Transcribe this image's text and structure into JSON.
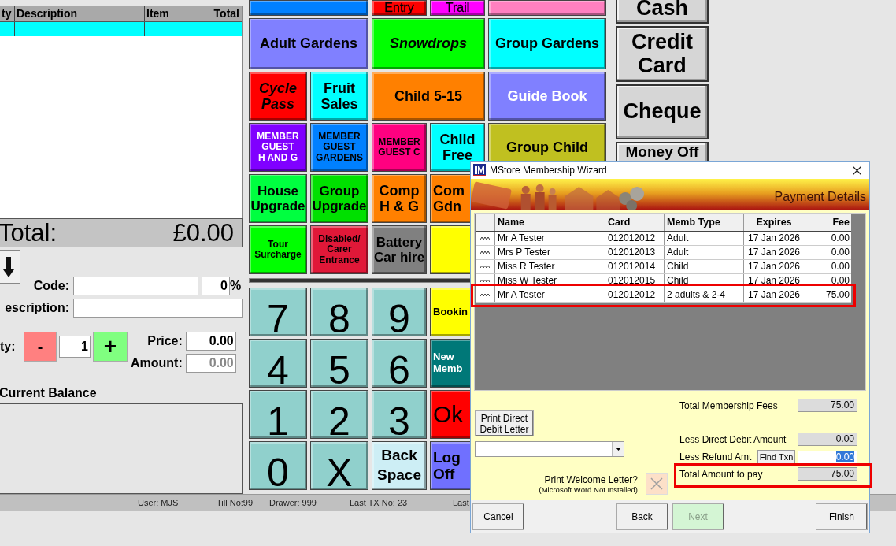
{
  "order_table": {
    "columns": [
      "ty",
      "Description",
      "Item",
      "Total"
    ]
  },
  "total": {
    "label": "Total:",
    "value": "£0.00"
  },
  "entry": {
    "code_label": "Code:",
    "discount": "0",
    "percent": "%",
    "description_label": "escription:",
    "qty_label": "ty:",
    "minus": "-",
    "qty": "1",
    "plus": "+",
    "price_label": "Price:",
    "price": "0.00",
    "amount_label": "Amount:",
    "amount": "0.00"
  },
  "balance": {
    "label": "Current Balance"
  },
  "product_buttons": [
    [
      {
        "color": "#0080ff",
        "kind": "large"
      },
      {
        "label": "Entry",
        "color": "#ff0000",
        "light_text": false,
        "italic": false,
        "kind": "top"
      },
      {
        "label": "Trail",
        "color": "#ff00ff",
        "light_text": false,
        "italic": false,
        "kind": "top"
      },
      {
        "color": "#ff80c0",
        "kind": "large"
      }
    ],
    [
      {
        "label": "Adult Gardens",
        "color": "#8080ff",
        "light_text": false,
        "italic": false,
        "kind": "large"
      },
      {
        "label": "Snowdrops",
        "color": "#00ff00",
        "light_text": false,
        "italic": true,
        "kind": "large"
      },
      {
        "label": "Group Gardens",
        "color": "#00ffff",
        "light_text": false,
        "italic": false,
        "kind": "large"
      }
    ],
    [
      {
        "label": "Cycle\nPass",
        "color": "#ff0000",
        "light_text": false,
        "italic": true,
        "kind": "large"
      },
      {
        "label": "Fruit\nSales",
        "color": "#00ffff",
        "light_text": false,
        "italic": false,
        "kind": "large"
      },
      {
        "label": "Child 5-15",
        "color": "#ff8000",
        "light_text": false,
        "italic": false,
        "kind": "large"
      },
      {
        "label": "Guide Book",
        "color": "#8080ff",
        "light_text": true,
        "italic": false,
        "kind": "large"
      }
    ],
    [
      {
        "label": "MEMBER\nGUEST\nH AND G",
        "color": "#8000ff",
        "light_text": true,
        "italic": false,
        "kind": "small"
      },
      {
        "label": "MEMBER\nGUEST\nGARDENS",
        "color": "#0080ff",
        "light_text": false,
        "italic": false,
        "kind": "small"
      },
      {
        "label": "MEMBER\nGUEST C",
        "color": "#ff0080",
        "light_text": false,
        "italic": false,
        "kind": "small"
      },
      {
        "label": "Child\nFree",
        "color": "#00ffff",
        "light_text": false,
        "italic": false,
        "kind": "large"
      },
      {
        "label": "Group Child",
        "color": "#c0c020",
        "light_text": false,
        "italic": false,
        "kind": "large"
      }
    ],
    [
      {
        "label": "House\nUpgrade",
        "color": "#00ff40",
        "light_text": false,
        "italic": false,
        "kind": "medium"
      },
      {
        "label": "Group\nUpgrade",
        "color": "#00e000",
        "light_text": false,
        "italic": false,
        "kind": "medium"
      },
      {
        "label": "Comp\nH & G",
        "color": "#ff8000",
        "light_text": false,
        "italic": false,
        "kind": "large"
      },
      {
        "label": "Com\nGdn",
        "color": "#ff8000",
        "light_text": false,
        "italic": false,
        "kind": "cut"
      }
    ],
    [
      {
        "label": "Tour\nSurcharge",
        "color": "#00ff00",
        "light_text": false,
        "italic": false,
        "kind": "small"
      },
      {
        "label": "Disabled/\nCarer\nEntrance",
        "color": "#e01838",
        "light_text": false,
        "italic": false,
        "kind": "small"
      },
      {
        "label": "Battery\nCar hire",
        "color": "#808080",
        "light_text": false,
        "italic": false,
        "kind": "medium"
      },
      {
        "color": "#ffff00",
        "kind": "large"
      }
    ]
  ],
  "keypad": [
    [
      {
        "label": "7",
        "color": "#90d0cc",
        "light_text": false,
        "kind": "digit"
      },
      {
        "label": "8",
        "color": "#90d0cc",
        "light_text": false,
        "kind": "digit"
      },
      {
        "label": "9",
        "color": "#90d0cc",
        "light_text": false,
        "kind": "digit"
      },
      {
        "label": "Bookin",
        "color": "#ffff00",
        "light_text": false,
        "kind": "cut"
      }
    ],
    [
      {
        "label": "4",
        "color": "#90d0cc",
        "light_text": false,
        "kind": "digit"
      },
      {
        "label": "5",
        "color": "#90d0cc",
        "light_text": false,
        "kind": "digit"
      },
      {
        "label": "6",
        "color": "#90d0cc",
        "light_text": false,
        "kind": "digit"
      },
      {
        "label": "New\nMemb",
        "color": "#007878",
        "light_text": true,
        "kind": "cut"
      }
    ],
    [
      {
        "label": "1",
        "color": "#90d0cc",
        "light_text": false,
        "kind": "digit"
      },
      {
        "label": "2",
        "color": "#90d0cc",
        "light_text": false,
        "kind": "digit"
      },
      {
        "label": "3",
        "color": "#90d0cc",
        "light_text": false,
        "kind": "digit"
      },
      {
        "label": "Ok",
        "color": "#ff0000",
        "light_text": false,
        "kind": "big-cut"
      }
    ],
    [
      {
        "label": "0",
        "color": "#90d0cc",
        "light_text": false,
        "kind": "digit"
      },
      {
        "label": "X",
        "color": "#90d0cc",
        "light_text": false,
        "kind": "digit"
      },
      {
        "label": "Back\nSpace",
        "color": "#cdeef5",
        "light_text": false,
        "kind": "word"
      },
      {
        "label": "Log\nOff",
        "color": "#7070ff",
        "light_text": false,
        "kind": "cut-large"
      }
    ]
  ],
  "payment_buttons": [
    "Cash",
    "Credit\nCard",
    "Cheque",
    "Money Off"
  ],
  "status_bar": [
    "User: MJS",
    "Till No:99",
    "Drawer: 999",
    "Last TX No: 23",
    "Last"
  ],
  "dialog": {
    "title": "MStore Membership Wizard",
    "heading": "Payment Details",
    "columns": [
      "Name",
      "Card",
      "Memb Type",
      "Expires",
      "Fee"
    ],
    "rows": [
      {
        "cells": [
          "Mr A Tester",
          "012012012",
          "Adult",
          "17 Jan 2026",
          "0.00"
        ],
        "highlighted": false
      },
      {
        "cells": [
          "Mrs P Tester",
          "012012013",
          "Adult",
          "17 Jan 2026",
          "0.00"
        ],
        "highlighted": false
      },
      {
        "cells": [
          "Miss R Tester",
          "012012014",
          "Child",
          "17 Jan 2026",
          "0.00"
        ],
        "highlighted": false
      },
      {
        "cells": [
          "Miss W Tester",
          "012012015",
          "Child",
          "17 Jan 2026",
          "0.00"
        ],
        "highlighted": false
      },
      {
        "cells": [
          "Mr A Tester",
          "012012012",
          "2 adults & 2-4",
          "17 Jan 2026",
          "75.00"
        ],
        "highlighted": true
      }
    ],
    "print_dd_button": "Print Direct\nDebit Letter",
    "welcome_label": "Print Welcome Letter?",
    "welcome_note": "(Microsoft Word Not Installed)",
    "welcome_disabled": true,
    "totals": [
      {
        "label": "Total Membership Fees",
        "value": "75.00",
        "kind": "readonly",
        "highlighted": false
      },
      {
        "label": "Less Direct Debit Amount",
        "value": "0.00",
        "kind": "readonly",
        "highlighted": false
      },
      {
        "label": "Less Refund Amt",
        "button": "Find Txn",
        "value": "0.00",
        "kind": "input",
        "highlighted": false
      },
      {
        "label": "Total Amount to pay",
        "value": "75.00",
        "kind": "readonly",
        "highlighted": true
      }
    ],
    "footer_buttons": [
      {
        "label": "Cancel",
        "disabled": false
      },
      {
        "label": "Back",
        "disabled": false
      },
      {
        "label": "Next",
        "disabled": true
      },
      {
        "label": "Finish",
        "disabled": false
      }
    ]
  }
}
